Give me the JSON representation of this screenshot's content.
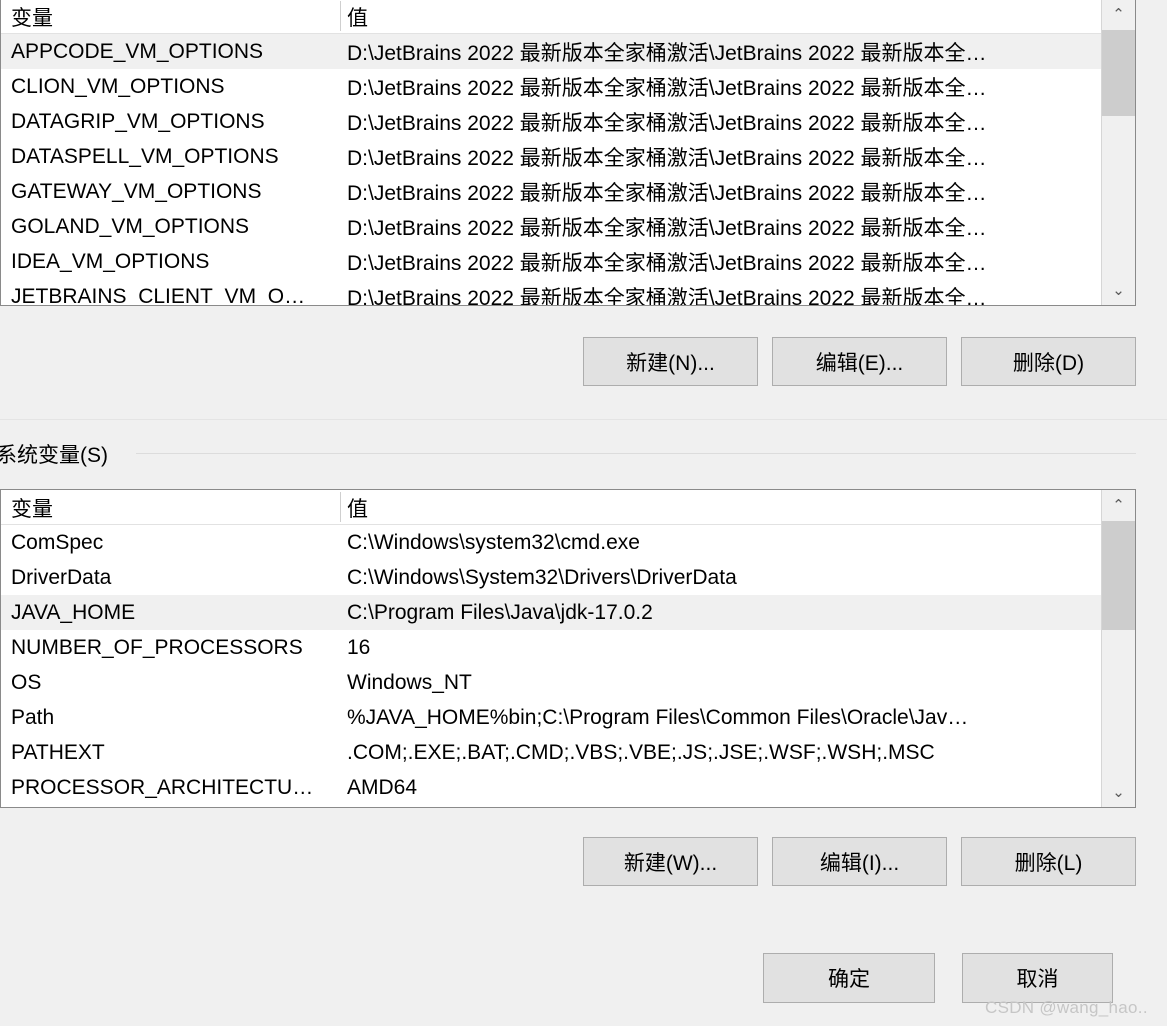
{
  "user_section": {
    "columns": {
      "variable": "变量",
      "value": "值"
    },
    "rows": [
      {
        "name": "APPCODE_VM_OPTIONS",
        "value": "D:\\JetBrains 2022 最新版本全家桶激活\\JetBrains 2022 最新版本全…",
        "selected": true
      },
      {
        "name": "CLION_VM_OPTIONS",
        "value": "D:\\JetBrains 2022 最新版本全家桶激活\\JetBrains 2022 最新版本全…",
        "selected": false
      },
      {
        "name": "DATAGRIP_VM_OPTIONS",
        "value": "D:\\JetBrains 2022 最新版本全家桶激活\\JetBrains 2022 最新版本全…",
        "selected": false
      },
      {
        "name": "DATASPELL_VM_OPTIONS",
        "value": "D:\\JetBrains 2022 最新版本全家桶激活\\JetBrains 2022 最新版本全…",
        "selected": false
      },
      {
        "name": "GATEWAY_VM_OPTIONS",
        "value": "D:\\JetBrains 2022 最新版本全家桶激活\\JetBrains 2022 最新版本全…",
        "selected": false
      },
      {
        "name": "GOLAND_VM_OPTIONS",
        "value": "D:\\JetBrains 2022 最新版本全家桶激活\\JetBrains 2022 最新版本全…",
        "selected": false
      },
      {
        "name": "IDEA_VM_OPTIONS",
        "value": "D:\\JetBrains 2022 最新版本全家桶激活\\JetBrains 2022 最新版本全…",
        "selected": false
      },
      {
        "name": "JETBRAINS_CLIENT_VM_O…",
        "value": "D:\\JetBrains 2022 最新版本全家桶激活\\JetBrains 2022 最新版本全…",
        "selected": false
      }
    ],
    "buttons": {
      "new": "新建(N)...",
      "edit": "编辑(E)...",
      "delete": "删除(D)"
    },
    "scrollbar": {
      "up": "⌃",
      "down": "⌄"
    }
  },
  "system_section": {
    "label": "系统变量(S)",
    "columns": {
      "variable": "变量",
      "value": "值"
    },
    "rows": [
      {
        "name": "ComSpec",
        "value": "C:\\Windows\\system32\\cmd.exe",
        "selected": false
      },
      {
        "name": "DriverData",
        "value": "C:\\Windows\\System32\\Drivers\\DriverData",
        "selected": false
      },
      {
        "name": "JAVA_HOME",
        "value": "C:\\Program Files\\Java\\jdk-17.0.2",
        "selected": true
      },
      {
        "name": "NUMBER_OF_PROCESSORS",
        "value": "16",
        "selected": false
      },
      {
        "name": "OS",
        "value": "Windows_NT",
        "selected": false
      },
      {
        "name": "Path",
        "value": "%JAVA_HOME%bin;C:\\Program Files\\Common Files\\Oracle\\Jav…",
        "selected": false
      },
      {
        "name": "PATHEXT",
        "value": ".COM;.EXE;.BAT;.CMD;.VBS;.VBE;.JS;.JSE;.WSF;.WSH;.MSC",
        "selected": false
      },
      {
        "name": "PROCESSOR_ARCHITECTU…",
        "value": "AMD64",
        "selected": false
      }
    ],
    "buttons": {
      "new": "新建(W)...",
      "edit": "编辑(I)...",
      "delete": "删除(L)"
    },
    "scrollbar": {
      "up": "⌃",
      "down": "⌄"
    }
  },
  "dialog_buttons": {
    "ok": "确定",
    "cancel": "取消"
  },
  "watermark": "CSDN @wang_hao..",
  "colors": {
    "dialog_bg": "#f0f0f0",
    "list_bg": "#ffffff",
    "row_selected": "#f0f0f0",
    "button_face": "#e1e1e1",
    "button_border": "#adadad",
    "list_border": "#8a8a8a",
    "scroll_thumb": "#cdcdcd",
    "watermark": "#c6c6c6"
  }
}
